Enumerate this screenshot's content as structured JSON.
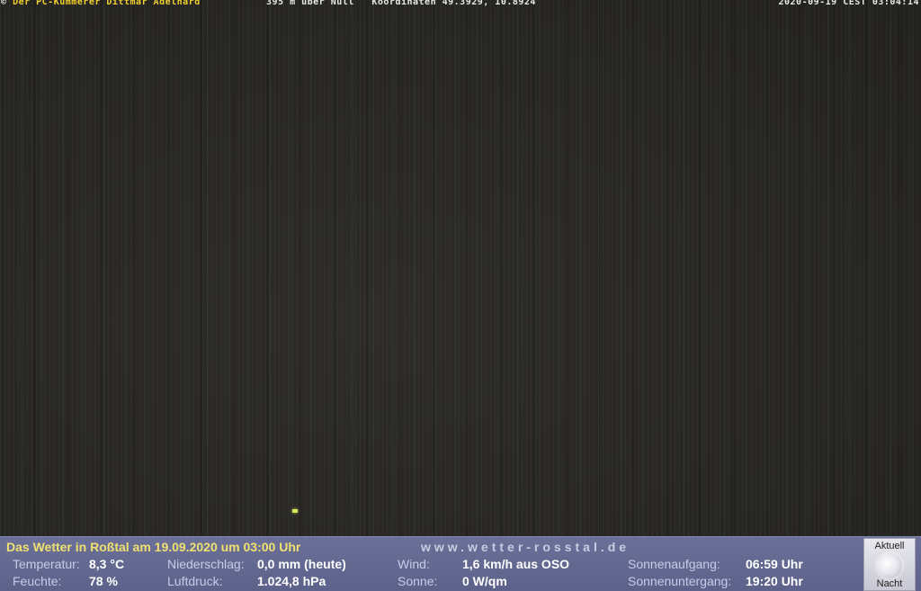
{
  "overlay": {
    "copyright_symbol": "©",
    "left_text": "Der PC-Kümmerer Dittmar Adelhard",
    "mid_text": "395 m über Null   Koordinaten 49.3929, 10.8924",
    "timestamp": "2020-09-19 CEST 03:04:14"
  },
  "panel": {
    "headline": "Das Wetter in Roßtal am 19.09.2020 um 03:00 Uhr",
    "website": "www.wetter-rosstal.de",
    "temperature": {
      "label": "Temperatur:",
      "value": "8,3 °C"
    },
    "humidity": {
      "label": "Feuchte:",
      "value": "78 %"
    },
    "precipitation": {
      "label": "Niederschlag:",
      "value": "0,0 mm (heute)"
    },
    "pressure": {
      "label": "Luftdruck:",
      "value": "1.024,8 hPa"
    },
    "wind": {
      "label": "Wind:",
      "value": "1,6 km/h aus OSO"
    },
    "sun": {
      "label": "Sonne:",
      "value": "0 W/qm"
    },
    "sunrise": {
      "label": "Sonnenaufgang:",
      "value": "06:59 Uhr"
    },
    "sunset": {
      "label": "Sonnenuntergang:",
      "value": "19:20 Uhr"
    },
    "moon": {
      "top_label": "Aktuell",
      "bottom_label": "Nacht",
      "icon": "moon-icon"
    }
  }
}
